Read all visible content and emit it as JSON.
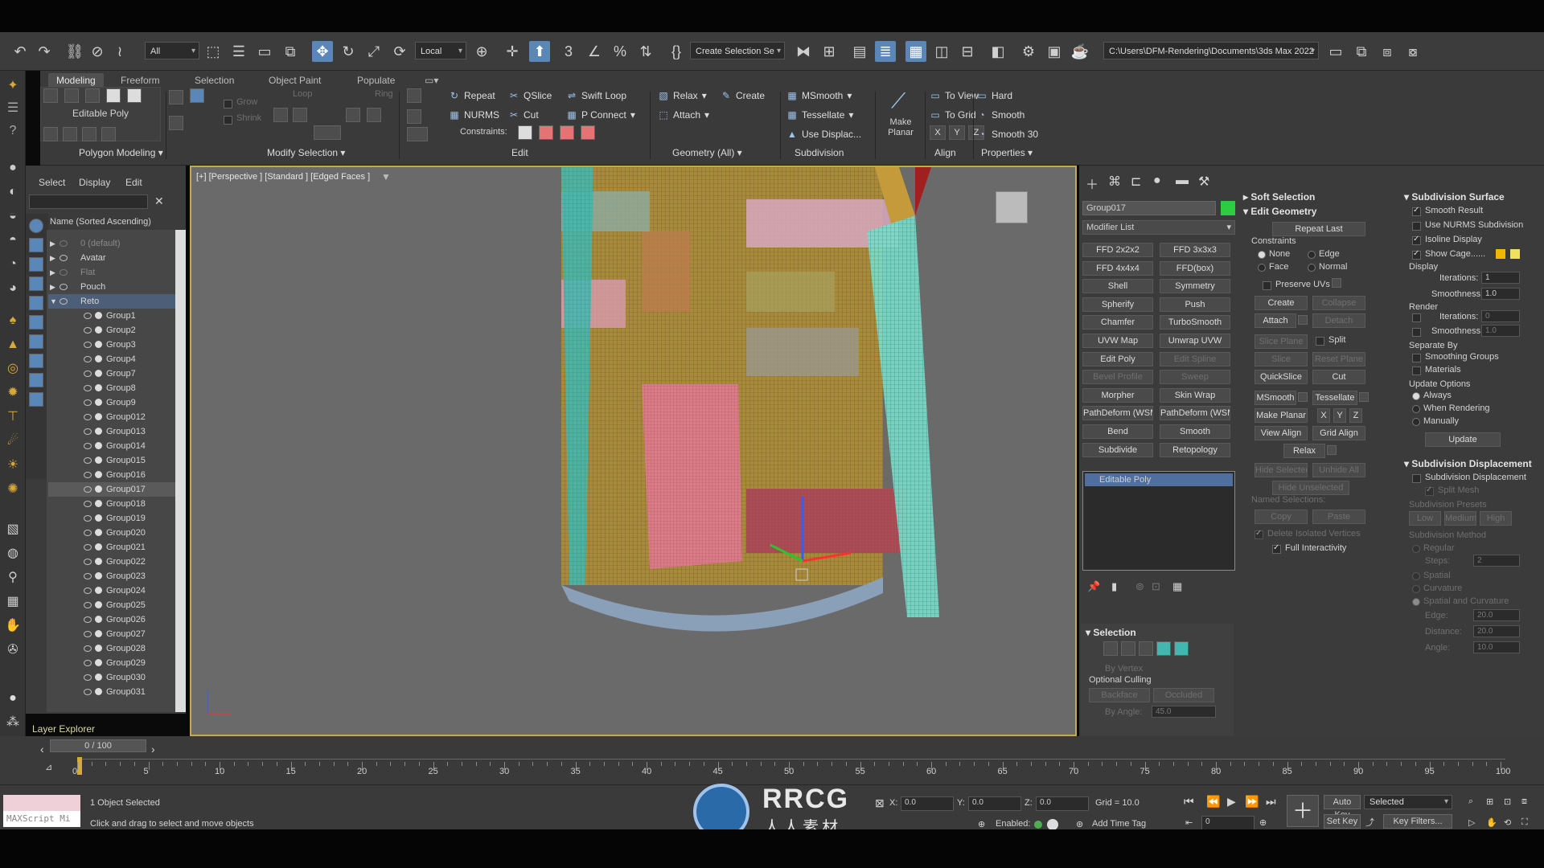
{
  "toolbar": {
    "selection_filter": "All",
    "coord_system": "Local",
    "named_selection": "Create Selection Se",
    "project_path": "C:\\Users\\DFM-Rendering\\Documents\\3ds Max 2022"
  },
  "ribbon": {
    "tabs": [
      "Modeling",
      "Freeform",
      "Selection",
      "Object Paint",
      "Populate"
    ],
    "active_tab": "Modeling",
    "poly_label": "Editable Poly",
    "grow_label": "Grow",
    "shrink_label": "Shrink",
    "loop_label": "Loop",
    "ring_label": "Ring",
    "groups": {
      "polygon_modeling": "Polygon Modeling",
      "modify_selection": "Modify Selection",
      "edit": "Edit",
      "geometry": "Geometry (All)",
      "subdivision": "Subdivision",
      "align": "Align",
      "properties": "Properties"
    },
    "edit_buttons": {
      "repeat": "Repeat",
      "qslice": "QSlice",
      "swift_loop": "Swift Loop",
      "nurms": "NURMS",
      "cut": "Cut",
      "p_connect": "P Connect",
      "constraints": "Constraints:"
    },
    "geometry_buttons": {
      "relax": "Relax",
      "create": "Create",
      "attach": "Attach"
    },
    "subdivision_buttons": {
      "msmooth": "MSmooth",
      "tessellate": "Tessellate",
      "use_displac": "Use Displac..."
    },
    "make_planar": "Make Planar",
    "align_buttons": {
      "to_view": "To View",
      "to_grid": "To Grid",
      "x": "X",
      "y": "Y",
      "z": "Z"
    },
    "properties_buttons": {
      "hard": "Hard",
      "smooth": "Smooth",
      "smooth30": "Smooth 30"
    }
  },
  "scene_explorer": {
    "menu": [
      "Select",
      "Display",
      "Edit"
    ],
    "column_header": "Name (Sorted Ascending)",
    "layers": [
      {
        "name": "0 (default)",
        "dim": true
      },
      {
        "name": "Avatar",
        "dim": false
      },
      {
        "name": "Flat",
        "dim": true
      },
      {
        "name": "Pouch",
        "dim": false
      },
      {
        "name": "Reto",
        "dim": false
      }
    ],
    "groups": [
      "Group1",
      "Group2",
      "Group3",
      "Group4",
      "Group7",
      "Group8",
      "Group9",
      "Group012",
      "Group013",
      "Group014",
      "Group015",
      "Group016",
      "Group017",
      "Group018",
      "Group019",
      "Group020",
      "Group021",
      "Group022",
      "Group023",
      "Group024",
      "Group025",
      "Group026",
      "Group027",
      "Group028",
      "Group029",
      "Group030",
      "Group031"
    ],
    "selected_group": "Group017",
    "footer": "Layer Explorer"
  },
  "viewport": {
    "label": "[+] [Perspective ] [Standard ] [Edged Faces ]"
  },
  "command_panel": {
    "object_name": "Group017",
    "object_color": "#2ecc40",
    "modifier_list_label": "Modifier List",
    "modifiers": [
      "FFD 2x2x2",
      "FFD 3x3x3",
      "FFD 4x4x4",
      "FFD(box)",
      "Shell",
      "Symmetry",
      "Spherify",
      "Push",
      "Chamfer",
      "TurboSmooth",
      "UVW Map",
      "Unwrap UVW",
      "Edit Poly",
      "Edit Spline",
      "Bevel Profile",
      "Sweep",
      "Morpher",
      "Skin Wrap",
      "PathDeform (WSM",
      "PathDeform (WSM",
      "Bend",
      "Smooth",
      "Subdivide",
      "Retopology"
    ],
    "dim_modifiers": [
      "Edit Spline",
      "Bevel Profile",
      "Sweep"
    ],
    "stack_item": "Editable Poly",
    "selection_rollout": {
      "title": "Selection",
      "by_vertex": "By Vertex",
      "optional_culling": "Optional Culling",
      "backface": "Backface",
      "occluded": "Occluded",
      "by_angle": "By Angle:",
      "angle_value": "45.0"
    },
    "soft_selection": "Soft Selection",
    "edit_geometry": {
      "title": "Edit Geometry",
      "repeat_last": "Repeat Last",
      "constraints": "Constraints",
      "none": "None",
      "edge": "Edge",
      "face": "Face",
      "normal": "Normal",
      "preserve_uvs": "Preserve UVs",
      "create": "Create",
      "collapse": "Collapse",
      "attach": "Attach",
      "detach": "Detach",
      "slice_plane": "Slice Plane",
      "split": "Split",
      "slice": "Slice",
      "reset_plane": "Reset Plane",
      "quickslice": "QuickSlice",
      "cut": "Cut",
      "msmooth": "MSmooth",
      "tessellate": "Tessellate",
      "make_planar": "Make Planar",
      "x": "X",
      "y": "Y",
      "z": "Z",
      "view_align": "View Align",
      "grid_align": "Grid Align",
      "relax": "Relax",
      "hide_selected": "Hide Selected",
      "unhide_all": "Unhide All",
      "hide_unselected": "Hide Unselected",
      "named_selections": "Named Selections:",
      "copy": "Copy",
      "paste": "Paste",
      "delete_isolated": "Delete Isolated Vertices",
      "full_interactivity": "Full Interactivity"
    },
    "subdivision_surface": {
      "title": "Subdivision Surface",
      "smooth_result": "Smooth Result",
      "use_nurms": "Use NURMS Subdivision",
      "isoline": "Isoline Display",
      "show_cage": "Show Cage......",
      "display": "Display",
      "iterations": "Iterations:",
      "iter_val": "1",
      "smoothness": "Smoothness:",
      "smooth_val": "1.0",
      "render": "Render",
      "r_iter_val": "0",
      "r_smooth_val": "1.0",
      "separate_by": "Separate By",
      "smoothing_groups": "Smoothing Groups",
      "materials": "Materials",
      "update_options": "Update Options",
      "always": "Always",
      "when_rendering": "When Rendering",
      "manually": "Manually",
      "update": "Update"
    },
    "subdivision_displacement": {
      "title": "Subdivision Displacement",
      "checkbox": "Subdivision Displacement",
      "split_mesh": "Split Mesh",
      "presets": "Subdivision Presets",
      "low": "Low",
      "medium": "Medium",
      "high": "High",
      "method": "Subdivision Method",
      "regular": "Regular",
      "steps": "Steps:",
      "steps_val": "2",
      "spatial": "Spatial",
      "curvature": "Curvature",
      "spatial_curv": "Spatial and Curvature",
      "edge": "Edge:",
      "edge_val": "20.0",
      "distance": "Distance:",
      "distance_val": "20.0",
      "angle": "Angle:",
      "angle_val": "10.0"
    }
  },
  "timeline": {
    "frame_readout": "0 / 100",
    "ticks": [
      "0",
      "5",
      "10",
      "15",
      "20",
      "25",
      "30",
      "35",
      "40",
      "45",
      "50",
      "55",
      "60",
      "65",
      "70",
      "75",
      "80",
      "85",
      "90",
      "95",
      "100"
    ]
  },
  "status": {
    "maxscript": "MAXScript Mi",
    "selected": "1 Object Selected",
    "prompt": "Click and drag to select and move objects",
    "x_label": "X:",
    "x_val": "0.0",
    "y_label": "Y:",
    "y_val": "0.0",
    "z_label": "Z:",
    "z_val": "0.0",
    "grid": "Grid = 10.0",
    "enabled": "Enabled:",
    "add_time_tag": "Add Time Tag",
    "auto_key": "Auto Key",
    "selected_dd": "Selected",
    "set_key": "Set Key",
    "key_filters": "Key Filters...",
    "frame_val": "0"
  },
  "watermark": {
    "text": "RRCG",
    "subtext": "人人素材"
  }
}
